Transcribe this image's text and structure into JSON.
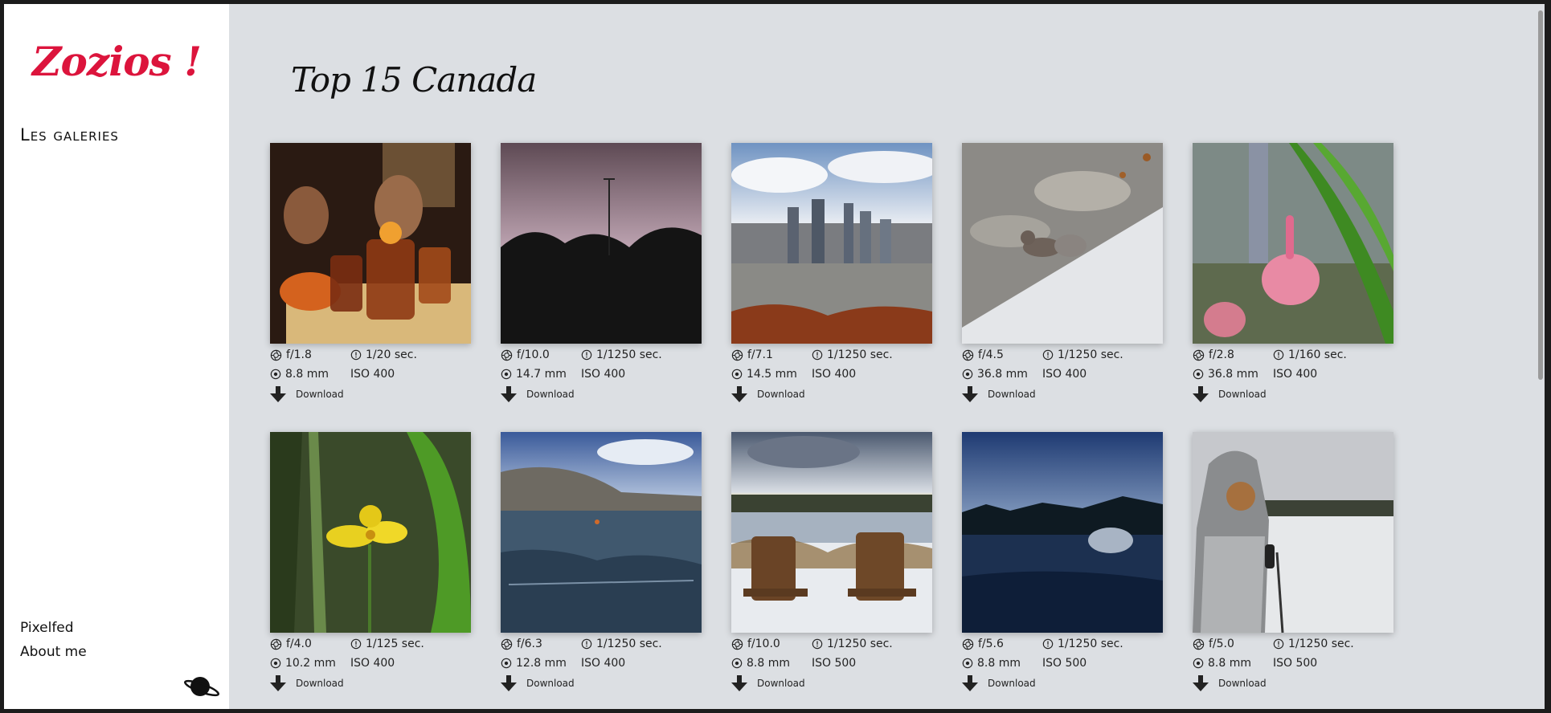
{
  "sidebar": {
    "logo": "Zozios !",
    "nav": {
      "galleries": "Les galeries"
    },
    "links": {
      "pixelfed": "Pixelfed",
      "about": "About me"
    }
  },
  "main": {
    "title": "Top 15 Canada",
    "download_label": "Download",
    "photos": [
      {
        "aperture": "f/1.8",
        "shutter": "1/20 sec.",
        "focal": "8.8 mm",
        "iso": "ISO 400"
      },
      {
        "aperture": "f/10.0",
        "shutter": "1/1250 sec.",
        "focal": "14.7 mm",
        "iso": "ISO 400"
      },
      {
        "aperture": "f/7.1",
        "shutter": "1/1250 sec.",
        "focal": "14.5 mm",
        "iso": "ISO 400"
      },
      {
        "aperture": "f/4.5",
        "shutter": "1/1250 sec.",
        "focal": "36.8 mm",
        "iso": "ISO 400"
      },
      {
        "aperture": "f/2.8",
        "shutter": "1/160 sec.",
        "focal": "36.8 mm",
        "iso": "ISO 400"
      },
      {
        "aperture": "f/4.0",
        "shutter": "1/125 sec.",
        "focal": "10.2 mm",
        "iso": "ISO 400"
      },
      {
        "aperture": "f/6.3",
        "shutter": "1/1250 sec.",
        "focal": "12.8 mm",
        "iso": "ISO 400"
      },
      {
        "aperture": "f/10.0",
        "shutter": "1/1250 sec.",
        "focal": "8.8 mm",
        "iso": "ISO 500"
      },
      {
        "aperture": "f/5.6",
        "shutter": "1/1250 sec.",
        "focal": "8.8 mm",
        "iso": "ISO 500"
      },
      {
        "aperture": "f/5.0",
        "shutter": "1/1250 sec.",
        "focal": "8.8 mm",
        "iso": "ISO 500"
      }
    ]
  },
  "colors": {
    "logo": "#dc143c",
    "content_bg": "#dcdfe3",
    "sidebar_bg": "#ffffff"
  }
}
